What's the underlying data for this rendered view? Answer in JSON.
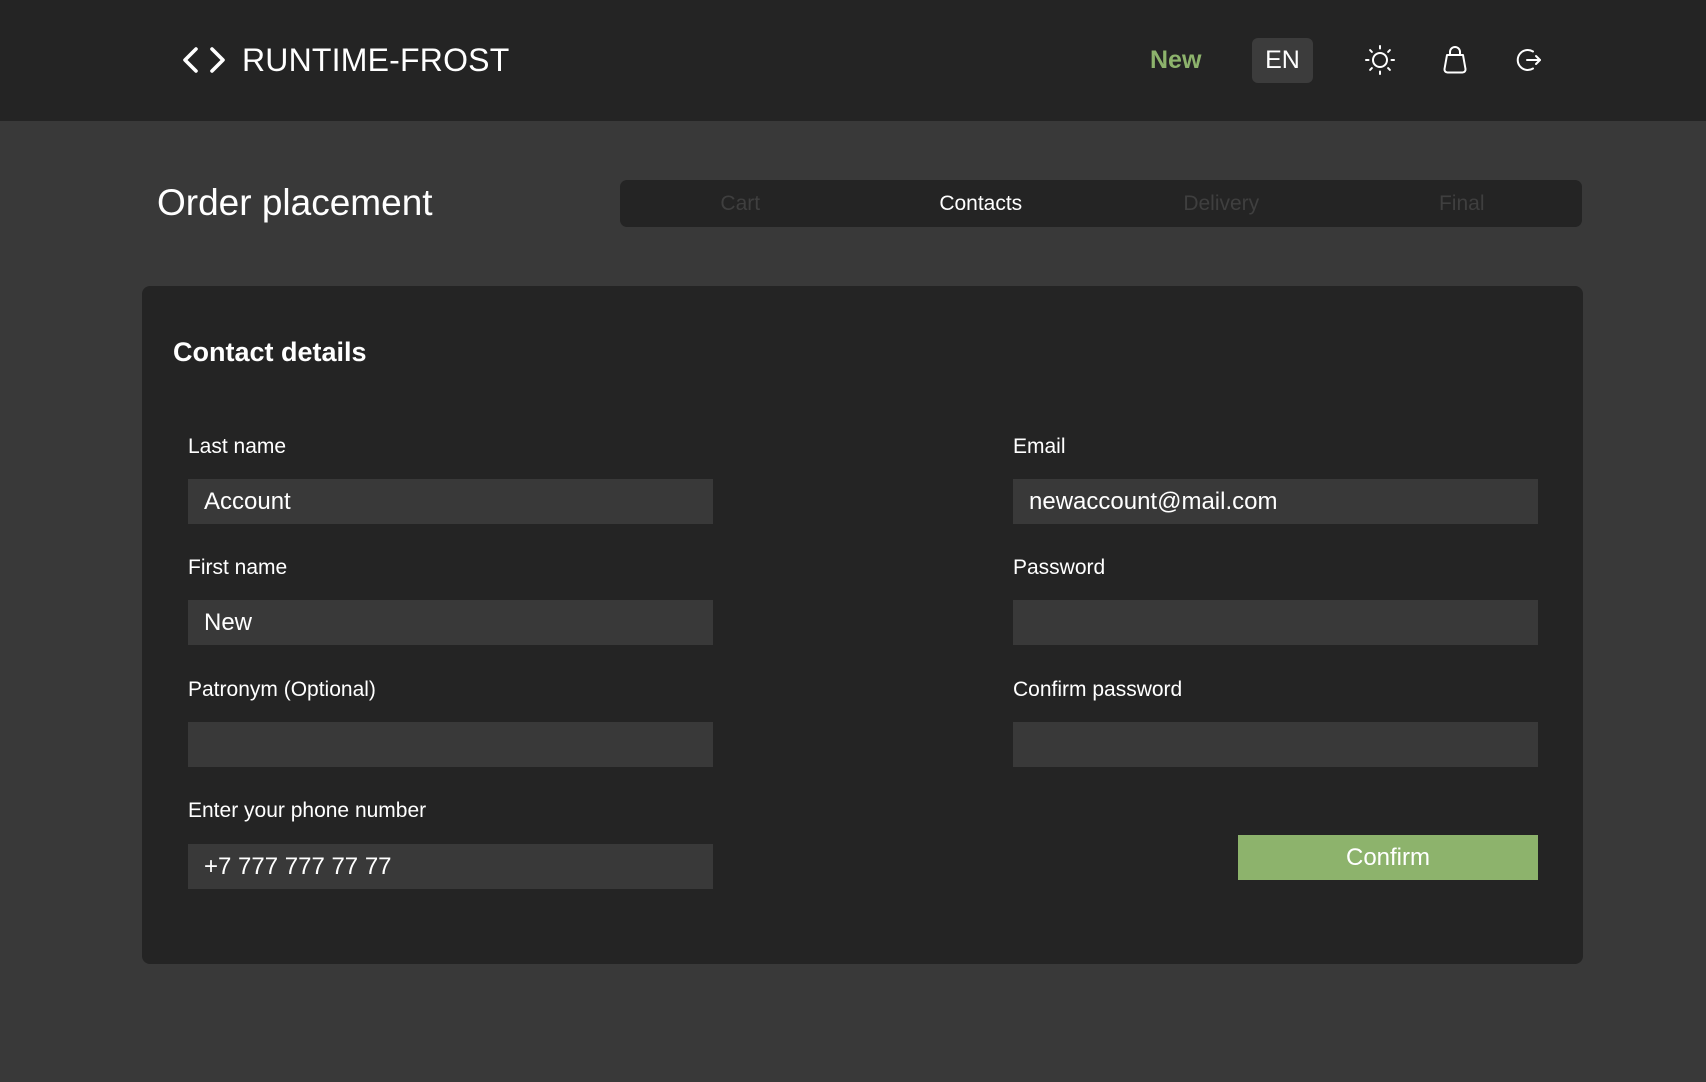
{
  "header": {
    "brand": "RUNTIME-FROST",
    "brand_icon": "code-brackets-icon",
    "user_name": "New",
    "language": "EN",
    "icons": [
      "sun-icon",
      "shopping-bag-icon",
      "logout-icon"
    ]
  },
  "page": {
    "title": "Order placement"
  },
  "steps": [
    {
      "label": "Cart",
      "state": "inactive"
    },
    {
      "label": "Contacts",
      "state": "active"
    },
    {
      "label": "Delivery",
      "state": "inactive"
    },
    {
      "label": "Final",
      "state": "inactive"
    }
  ],
  "form": {
    "title": "Contact details",
    "last_name": {
      "label": "Last name",
      "value": "Account"
    },
    "first_name": {
      "label": "First name",
      "value": "New"
    },
    "patronym": {
      "label": "Patronym (Optional)",
      "value": ""
    },
    "phone": {
      "label": "Enter your phone number",
      "value": "+7 777 777 77 77"
    },
    "email": {
      "label": "Email",
      "value": "newaccount@mail.com"
    },
    "password": {
      "label": "Password",
      "value": ""
    },
    "confirm_password": {
      "label": "Confirm password",
      "value": ""
    },
    "confirm_label": "Confirm"
  },
  "colors": {
    "accent": "#8db36c",
    "header_bg": "#242424",
    "page_bg": "#393939",
    "card_bg": "#242424",
    "input_bg": "#393939",
    "inactive_step": "#3f3f3f"
  }
}
